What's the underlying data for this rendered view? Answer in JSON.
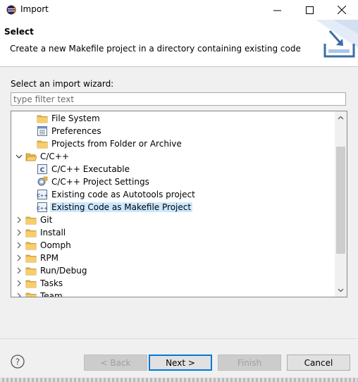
{
  "window": {
    "title": "Import"
  },
  "banner": {
    "title": "Select",
    "description": "Create a new Makefile project in a directory containing existing code"
  },
  "wizard": {
    "label": "Select an import wizard:",
    "filter_placeholder": "type filter text"
  },
  "tree": {
    "items": [
      {
        "label": "File System",
        "icon": "folder-icon",
        "level": 1
      },
      {
        "label": "Preferences",
        "icon": "preferences-icon",
        "level": 1
      },
      {
        "label": "Projects from Folder or Archive",
        "icon": "folder-icon",
        "level": 1
      },
      {
        "label": "C/C++",
        "icon": "open-folder-icon",
        "level": 0,
        "expanded": true
      },
      {
        "label": "C/C++ Executable",
        "icon": "c-file-icon",
        "level": 1
      },
      {
        "label": "C/C++ Project Settings",
        "icon": "settings-icon",
        "level": 1
      },
      {
        "label": "Existing code as Autotools project",
        "icon": "cpp-project-icon",
        "level": 1
      },
      {
        "label": "Existing Code as Makefile Project",
        "icon": "cpp-project-icon",
        "level": 1,
        "selected": true
      },
      {
        "label": "Git",
        "icon": "folder-icon",
        "level": 0,
        "expanded": false
      },
      {
        "label": "Install",
        "icon": "folder-icon",
        "level": 0,
        "expanded": false
      },
      {
        "label": "Oomph",
        "icon": "folder-icon",
        "level": 0,
        "expanded": false
      },
      {
        "label": "RPM",
        "icon": "folder-icon",
        "level": 0,
        "expanded": false
      },
      {
        "label": "Run/Debug",
        "icon": "folder-icon",
        "level": 0,
        "expanded": false
      },
      {
        "label": "Tasks",
        "icon": "folder-icon",
        "level": 0,
        "expanded": false
      },
      {
        "label": "Team",
        "icon": "folder-icon",
        "level": 0,
        "expanded": false
      }
    ]
  },
  "buttons": {
    "back": "< Back",
    "next": "Next >",
    "finish": "Finish",
    "cancel": "Cancel"
  },
  "colors": {
    "selection": "#cce8ff",
    "default_button_border": "#0078d7",
    "folder": "#e8b548"
  }
}
